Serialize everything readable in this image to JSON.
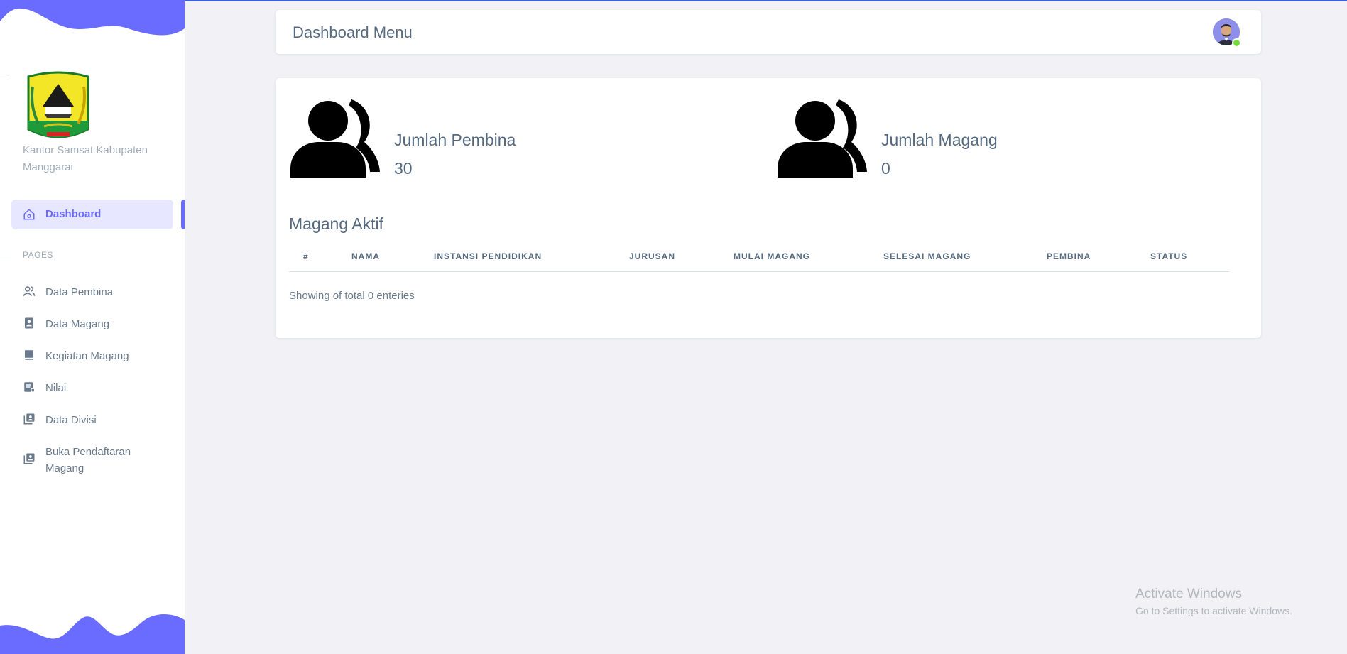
{
  "app": {
    "org_name": "Kantor Samsat Kabupaten Manggarai",
    "accent_color": "#696cff"
  },
  "sidebar": {
    "active_item": {
      "label": "Dashboard",
      "icon": "home-icon"
    },
    "section_header": "PAGES",
    "items": [
      {
        "label": "Data Pembina",
        "icon": "users-icon"
      },
      {
        "label": "Data Magang",
        "icon": "id-card-icon"
      },
      {
        "label": "Kegiatan Magang",
        "icon": "book-icon"
      },
      {
        "label": "Nilai",
        "icon": "grade-icon"
      },
      {
        "label": "Data Divisi",
        "icon": "contacts-icon"
      },
      {
        "label": "Buka Pendaftaran Magang",
        "icon": "contacts-icon"
      }
    ]
  },
  "navbar": {
    "title": "Dashboard Menu",
    "avatar_icon": "user-avatar-icon",
    "status": "online"
  },
  "stats": [
    {
      "label": "Jumlah Pembina",
      "value": "30",
      "icon": "user-group-icon"
    },
    {
      "label": "Jumlah Magang",
      "value": "0",
      "icon": "user-group-icon"
    }
  ],
  "table": {
    "title": "Magang Aktif",
    "columns": [
      "#",
      "NAMA",
      "INSTANSI PENDIDIKAN",
      "JURUSAN",
      "MULAI MAGANG",
      "SELESAI MAGANG",
      "PEMBINA",
      "STATUS"
    ],
    "rows": [],
    "footer": "Showing of total 0 enteries"
  },
  "watermark": {
    "title": "Activate Windows",
    "subtitle": "Go to Settings to activate Windows."
  }
}
